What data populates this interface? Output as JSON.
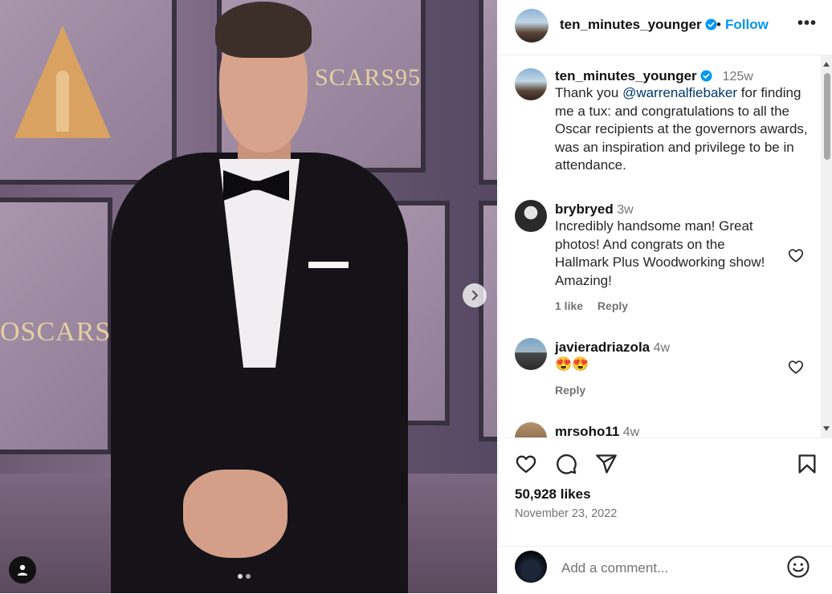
{
  "post": {
    "owner": "ten_minutes_younger",
    "follow_label": "Follow",
    "separator": "•",
    "more_label": "•••",
    "photo_brand_1": "SCARS95",
    "photo_brand_2": "OSCARS",
    "caption": {
      "username": "ten_minutes_younger",
      "time": "125w",
      "text_before": "Thank you ",
      "mention": "@warrenalfiebaker",
      "text_after": " for finding me a tux: and congratulations to all the Oscar recipients at the governors awards, was an inspiration and privilege to be in attendance."
    },
    "comments": [
      {
        "username": "brybryed",
        "time": "3w",
        "text": "Incredibly handsome man! Great photos! And congrats on the Hallmark Plus Woodworking show! Amazing!",
        "likes": "1 like",
        "reply": "Reply"
      },
      {
        "username": "javieradriazola",
        "time": "4w",
        "text": "😍😍",
        "reply": "Reply"
      },
      {
        "username": "mrsoho11",
        "time": "4w"
      }
    ],
    "likes_count": "50,928 likes",
    "date": "November 23, 2022",
    "add_comment_placeholder": "Add a comment...",
    "colors": {
      "follow": "#0095f6",
      "mention": "#00376b",
      "muted": "#737373"
    },
    "icons": [
      "heart-icon",
      "comment-icon",
      "share-icon",
      "bookmark-icon",
      "emoji-icon",
      "chevron-right-icon",
      "user-tag-icon",
      "verified-badge-icon"
    ]
  }
}
